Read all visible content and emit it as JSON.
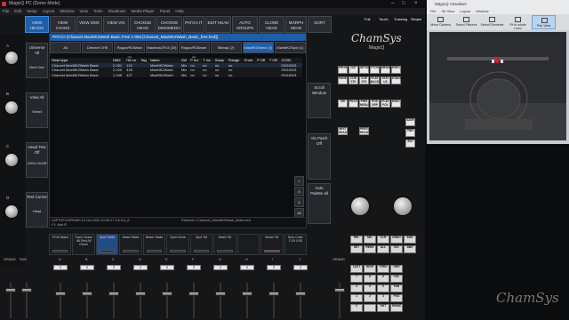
{
  "window": {
    "title": "MagicQ PC (Demo Mode)",
    "controls": [
      "–",
      "□",
      "×"
    ]
  },
  "menu": [
    "File",
    "Edit",
    "Setup",
    "Layout",
    "Window",
    "View",
    "Tools",
    "Shutdown",
    "Media Player",
    "Panel",
    "Help"
  ],
  "top_buttons": [
    {
      "label": "VIEW HEADS",
      "active": true
    },
    {
      "label": "VIEW CHANS"
    },
    {
      "label": "VIEW DMX"
    },
    {
      "label": "VIEW VIS"
    },
    {
      "label": "CHOOSE HEAD"
    },
    {
      "label": "CHOOSE DMX/MEDIA"
    },
    {
      "label": "PATCH IT"
    },
    {
      "label": "EDIT HEAD"
    },
    {
      "label": "AUTO GROUPS"
    },
    {
      "label": "CLONE HEAD"
    },
    {
      "label": "MORPH HEAD"
    },
    {
      "label": "SORT"
    }
  ],
  "right_top": [
    "Full",
    "Touch",
    "Tracking",
    "Simple"
  ],
  "left_side": [
    {
      "label": "Universe All",
      "sub": "Next Univ"
    },
    {
      "label": "View All",
      "sub": "Select"
    },
    {
      "label": "Head Test Off",
      "sub": "100%  On/Off"
    },
    {
      "label": "Test Cursor",
      "sub": "Head"
    }
  ],
  "knob_letters": [
    "A",
    "B",
    "C",
    "D"
  ],
  "patch": {
    "title": "PATCH (Chauvet MaxMK2Wash Basic Free 1-065 [Chauvet_MaxMK2Wash_Basic_free.hed])",
    "tabs": [
      "All",
      "Dimmer CHE",
      "Rogue/R1Wash (6)",
      "Maverick2Fx3 (20)",
      "Rogue/R1Beam (6)",
      "Bitmap (2)",
      "MaxMK2Wash (2)",
      "MaxMK2Spot (1)"
    ],
    "active_tab": 6,
    "columns": [
      "Head type",
      "DMX",
      "Hd no",
      "Tag",
      "Name",
      "Gel",
      "P Inv",
      "T Inv",
      "Swap",
      "Flange",
      "From",
      "P Off",
      "T Off",
      "JCSN"
    ],
    "rows": [
      [
        "Chauvet MaxMK2Wash Basic",
        "2-001",
        "113",
        "",
        "MaxMK2Wash",
        "Mix",
        "no",
        "no",
        "no",
        "no",
        "",
        "",
        "",
        "00110001"
      ],
      [
        "Chauvet MaxMK2Wash Basic",
        "2-020",
        "426",
        "",
        "MaxMK2Wash",
        "Mix",
        "no",
        "no",
        "no",
        "no",
        "",
        "",
        "",
        "00110001"
      ],
      [
        "Chauvet MaxMK2Wash Basic",
        "1-045",
        "427",
        "",
        "MaxMK2Wash",
        "Mix",
        "no",
        "no",
        "no",
        "no",
        "",
        "",
        "",
        "00110001"
      ]
    ],
    "scroll": [
      "<",
      "∧",
      "∨",
      "all"
    ],
    "status": "LAPTOP-E0PEMIS 19 Oct 2020 10:00:17 1.8.9.0_A",
    "status_right": "Patched 1 Chauvet_MaxMK2Wash_Basic.hed",
    "cmd": "F1: Add R"
  },
  "right_side": [
    "Scroll Window",
    "Vis Patch Off",
    "Auto Palette all"
  ],
  "logo": {
    "name": "ChamSys",
    "sub": "MagicQ"
  },
  "keypad": [
    [
      "PROG",
      "OUT",
      "SETUP",
      "PTCH",
      "MEDIA",
      "EXEC"
    ],
    [
      "PAGE",
      "CUE STK",
      "CUE STK",
      "PLAY BACK",
      "STAT US",
      "STACK"
    ],
    [
      "VIS",
      "PILOT",
      "PRIO MENU",
      "POS GRP",
      "PLAY PCK",
      "EXEC"
    ],
    [
      "NEXT HEAD",
      "PREV HEAD",
      "SAVE",
      "FAN",
      "ALL"
    ]
  ],
  "playbacks": [
    {
      "label": "PCM Wash",
      "sub": ""
    },
    {
      "label": "Face Chase",
      "sub": "All Red  All Green"
    },
    {
      "label": "Spot Static",
      "sub": "",
      "active": true
    },
    {
      "label": "Wash Static",
      "sub": ""
    },
    {
      "label": "Beam Static",
      "sub": ""
    },
    {
      "label": "Spot Circle",
      "sub": ""
    },
    {
      "label": "Spot Tilt",
      "sub": ""
    },
    {
      "label": "Wash Tilt",
      "sub": ""
    },
    {
      "label": "",
      "sub": ""
    },
    {
      "label": "Beam Tilt",
      "sub": ""
    },
    {
      "label": "Spot Color",
      "sub": "1.00  0.00"
    }
  ],
  "fader_labels": [
    "GRAND",
    "SUB",
    "A",
    "B",
    "C",
    "D",
    "E",
    "F",
    "G",
    "H",
    "I",
    "J"
  ],
  "fader_buttons": [
    "S",
    "S",
    "S",
    "S",
    "S",
    "S",
    "S",
    "S",
    "S",
    "S",
    "S",
    "S"
  ],
  "bottom_keys": [
    [
      "REL",
      "SEL",
      "CLR",
      "UNDO",
      "ADD",
      "MOVE",
      "COPY"
    ],
    [
      "SET",
      "REMV",
      "ALL",
      "INC",
      "ABS"
    ],
    [
      "LAST",
      "HIGH",
      "THRU",
      "ORG"
    ],
    [
      "7",
      "8",
      "9",
      "COL"
    ],
    [
      "4",
      "5",
      "6",
      "FAN"
    ],
    [
      "1",
      "2",
      "3",
      "POS"
    ],
    [
      "0",
      ".",
      "ENT",
      "BEAM"
    ]
  ],
  "bottom_right_labels": [
    "GRAND"
  ],
  "visualiser": {
    "title": "MagicQ Visualiser",
    "menu": [
      "File",
      "3D View",
      "Layout",
      "Window"
    ],
    "tools": [
      "Move Camera",
      "Select Fixtures",
      "Select Elements",
      "Fit to whole room",
      "Pan View"
    ],
    "active_tool": 4
  },
  "watermark": "ChamSys"
}
